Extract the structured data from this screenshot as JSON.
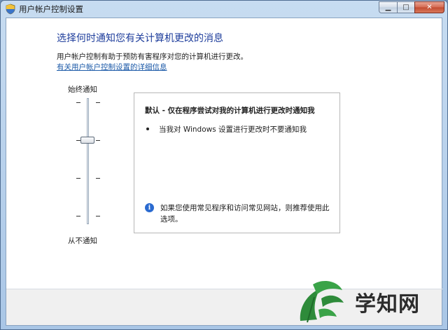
{
  "window": {
    "title": "用户帐户控制设置"
  },
  "titlebar": {
    "min_glyph": "▁",
    "max_glyph": "□",
    "close_glyph": "✕"
  },
  "main": {
    "heading": "选择何时通知您有关计算机更改的消息",
    "description": "用户帐户控制有助于预防有害程序对您的计算机进行更改。",
    "link": "有关用户帐户控制设置的详细信息"
  },
  "slider": {
    "top_label": "始终通知",
    "bottom_label": "从不通知",
    "levels": 4,
    "selected_level": 3
  },
  "panel": {
    "title": "默认 - 仅在程序尝试对我的计算机进行更改时通知我",
    "bullet": "当我对 Windows 设置进行更改时不要通知我",
    "info_icon": "info-icon",
    "info_text": "如果您使用常见程序和访问常见网站，则推荐使用此选项。"
  },
  "watermark": {
    "text": "学知网"
  },
  "colors": {
    "heading": "#1f3e9c",
    "link": "#1c5aa8",
    "close_button": "#c24a30"
  }
}
